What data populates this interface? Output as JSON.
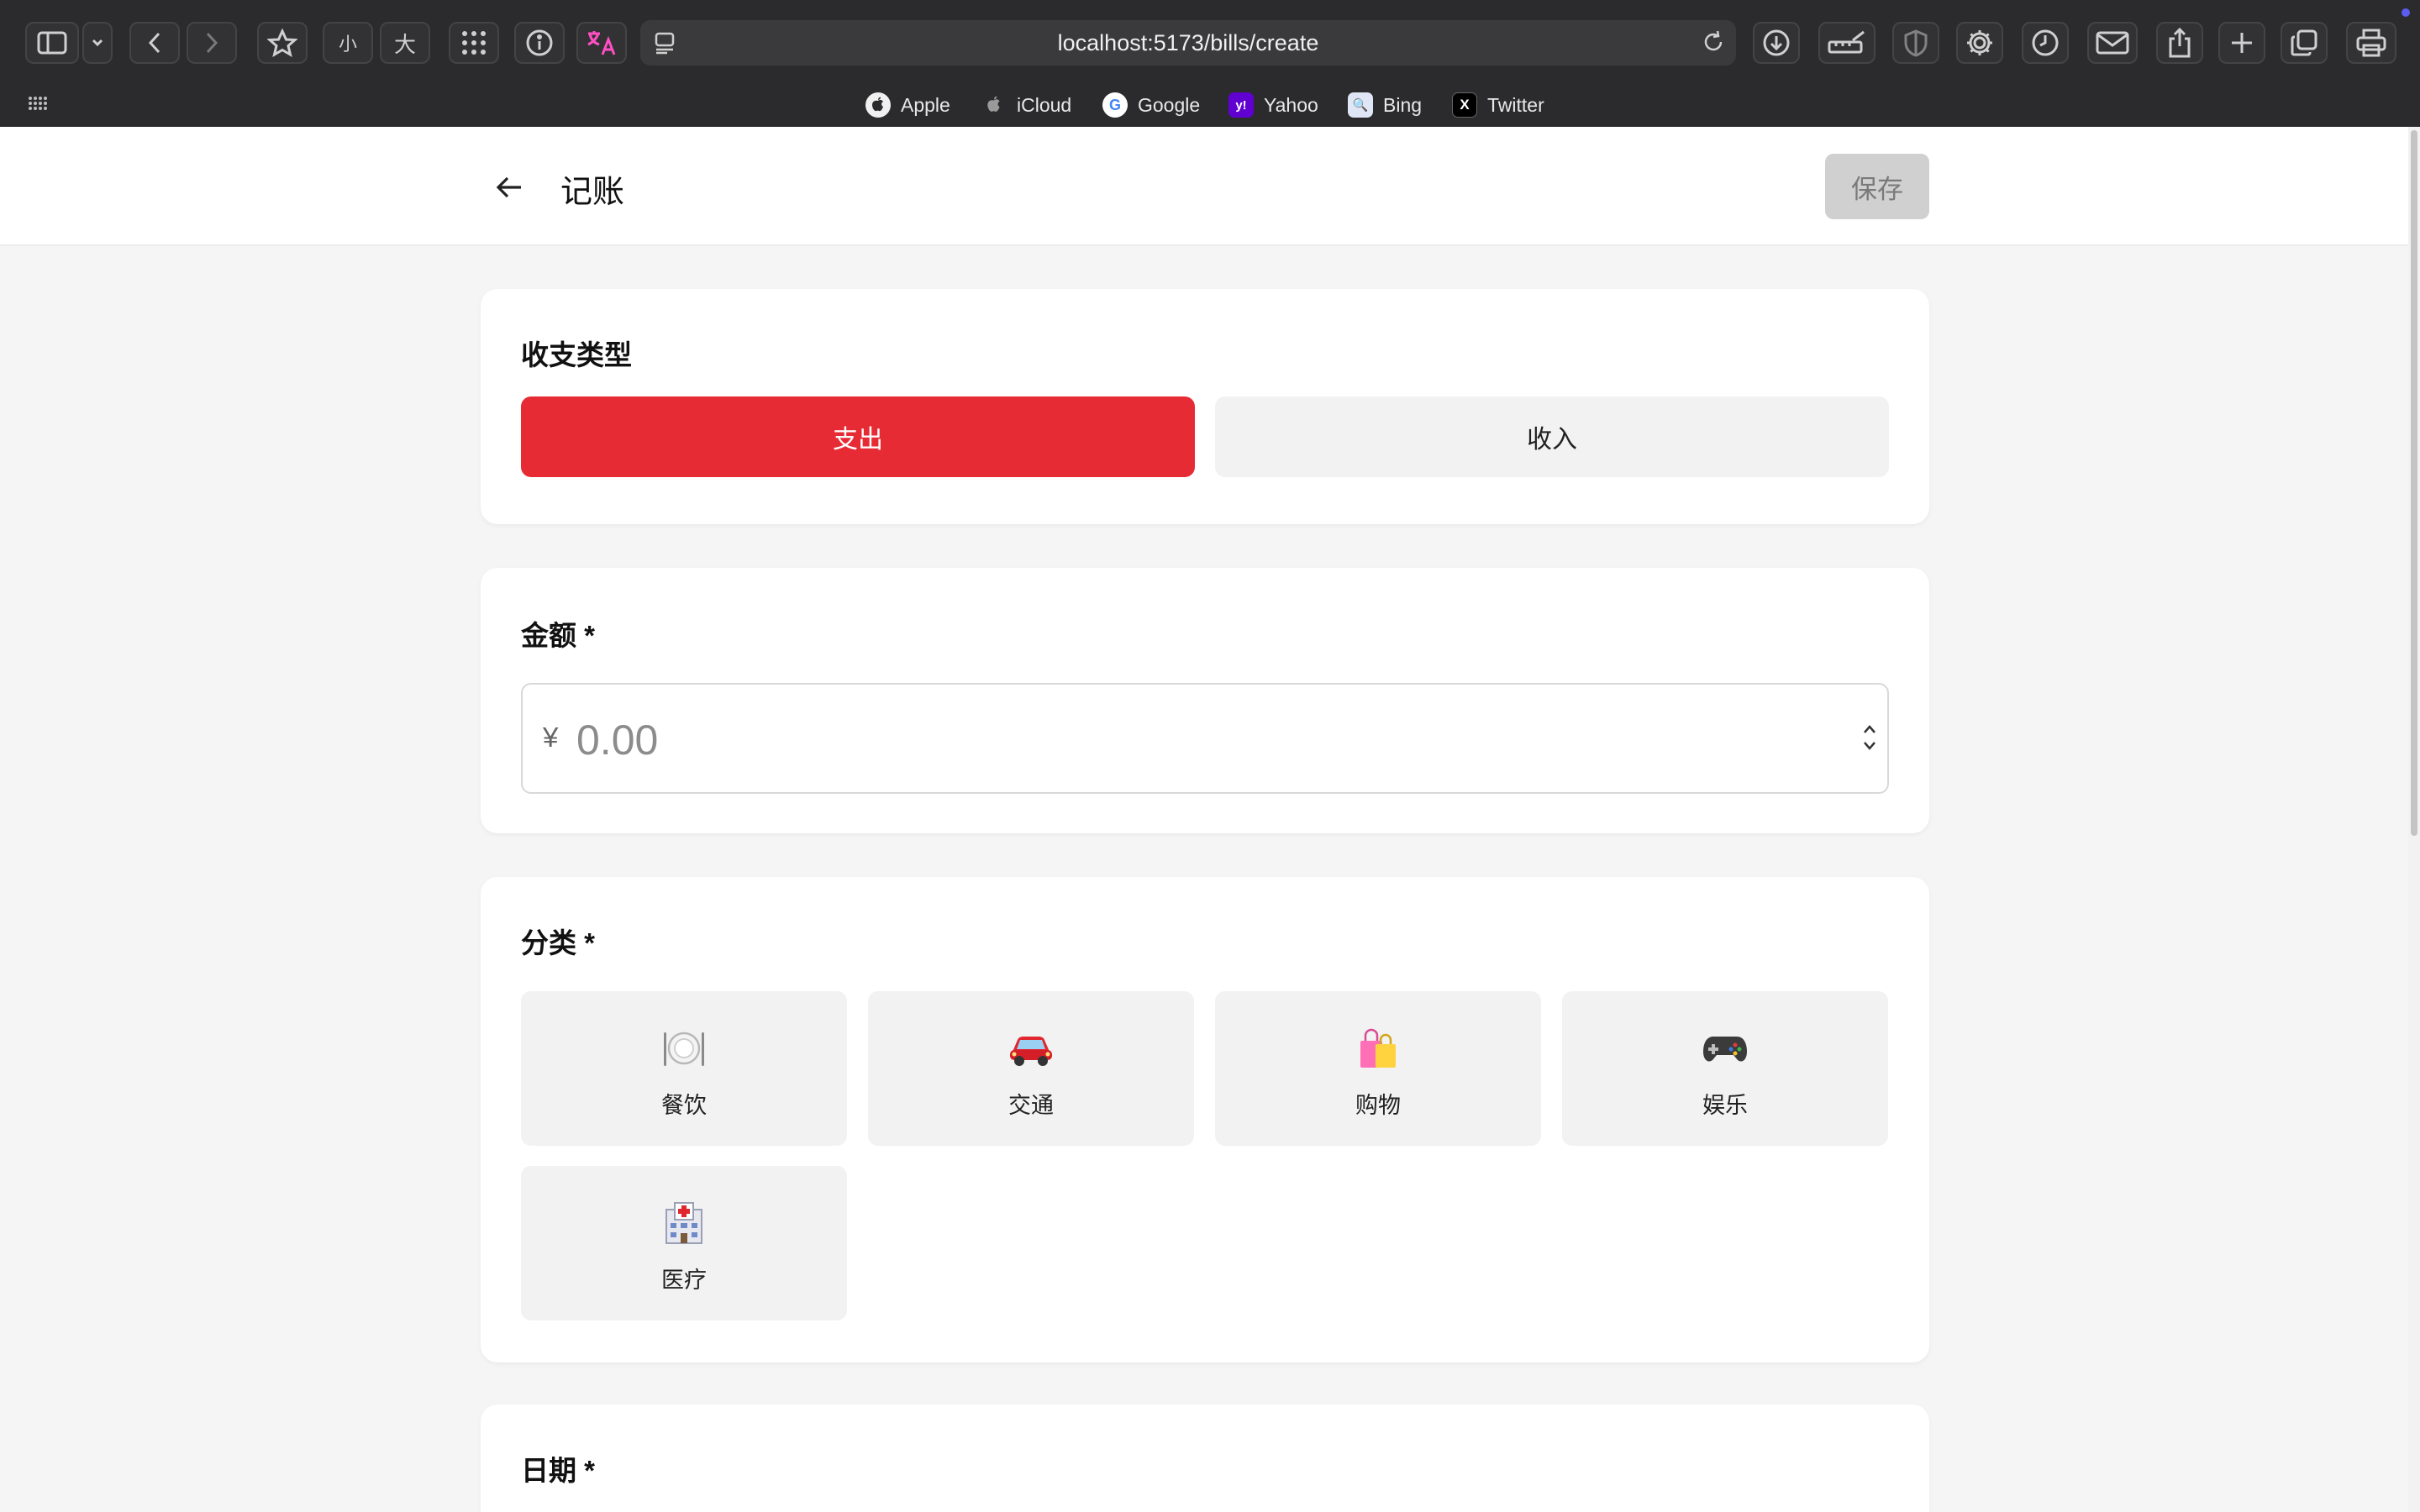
{
  "browser": {
    "url": "localhost:5173/bills/create",
    "text_small": "小",
    "text_large": "大",
    "bookmarks": [
      {
        "label": "Apple",
        "icon": "apple-icon"
      },
      {
        "label": "iCloud",
        "icon": "icloud-icon"
      },
      {
        "label": "Google",
        "icon": "google-icon",
        "glyph": "G"
      },
      {
        "label": "Yahoo",
        "icon": "yahoo-icon",
        "glyph": "y!"
      },
      {
        "label": "Bing",
        "icon": "bing-icon",
        "glyph": "🔍"
      },
      {
        "label": "Twitter",
        "icon": "twitter-icon",
        "glyph": "X"
      }
    ]
  },
  "header": {
    "title": "记账",
    "save_label": "保存"
  },
  "type_section": {
    "title": "收支类型",
    "options": [
      {
        "label": "支出",
        "active": true
      },
      {
        "label": "收入",
        "active": false
      }
    ]
  },
  "amount_section": {
    "title": "金额 *",
    "currency": "¥",
    "placeholder": "0.00"
  },
  "category_section": {
    "title": "分类 *",
    "items": [
      {
        "label": "餐饮",
        "emoji": "🍽️",
        "icon": "dining-icon"
      },
      {
        "label": "交通",
        "emoji": "🚗",
        "icon": "car-icon"
      },
      {
        "label": "购物",
        "emoji": "🛍️",
        "icon": "shopping-bags-icon"
      },
      {
        "label": "娱乐",
        "emoji": "🎮",
        "icon": "game-controller-icon"
      },
      {
        "label": "医疗",
        "emoji": "🏥",
        "icon": "hospital-icon"
      }
    ]
  },
  "date_section": {
    "title": "日期 *"
  },
  "colors": {
    "expense_active": "#e62b35",
    "inactive_button": "#f2f2f2",
    "save_disabled": "#d0d0d0",
    "page_background": "#f5f5f5"
  }
}
